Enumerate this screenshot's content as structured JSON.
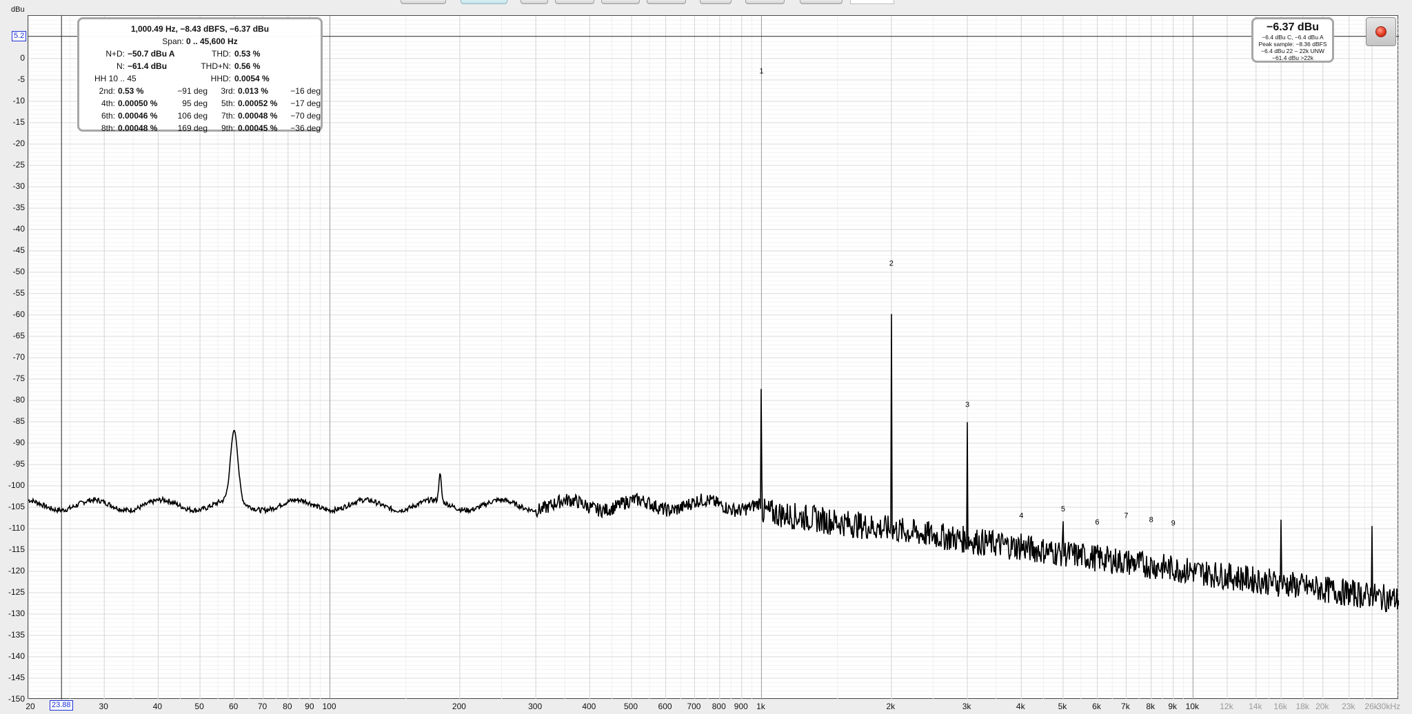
{
  "axis": {
    "unit": "dBu",
    "y_ticks": [
      "0",
      "-5",
      "-10",
      "-15",
      "-20",
      "-25",
      "-30",
      "-35",
      "-40",
      "-45",
      "-50",
      "-55",
      "-60",
      "-65",
      "-70",
      "-75",
      "-80",
      "-85",
      "-90",
      "-95",
      "-100",
      "-105",
      "-110",
      "-115",
      "-120",
      "-125",
      "-130",
      "-135",
      "-140",
      "-145",
      "-150"
    ],
    "x_ticks": [
      "20",
      "30",
      "40",
      "50",
      "60",
      "70",
      "80",
      "90",
      "100",
      "200",
      "300",
      "400",
      "500",
      "600",
      "700",
      "800",
      "900",
      "1k",
      "2k",
      "3k",
      "4k",
      "5k",
      "6k",
      "7k",
      "8k",
      "9k",
      "10k",
      "12k",
      "14k",
      "16k",
      "18k",
      "20k",
      "23k",
      "26k",
      "30kHz"
    ],
    "x_tick_values": [
      20,
      30,
      40,
      50,
      60,
      70,
      80,
      90,
      100,
      200,
      300,
      400,
      500,
      600,
      700,
      800,
      900,
      1000,
      2000,
      3000,
      4000,
      5000,
      6000,
      7000,
      8000,
      9000,
      10000,
      12000,
      14000,
      16000,
      18000,
      20000,
      23000,
      26000,
      30000
    ]
  },
  "cursor": {
    "level": "5.2",
    "freq": "23.88"
  },
  "stats": {
    "header": "1,000.49 Hz, −8.43 dBFS, −6.37 dBu",
    "span_label": "Span:",
    "span_value": "0 .. 45,600 Hz",
    "nd_label": "N+D:",
    "nd_value": "−50.7 dBu A",
    "thd_label": "THD:",
    "thd_value": "0.53 %",
    "n_label": "N:",
    "n_value": "−61.4 dBu",
    "thdn_label": "THD+N:",
    "thdn_value": "0.56 %",
    "hh_label": "HH 10 .. 45",
    "hhd_label": "HHD:",
    "hhd_value": "0.0054 %",
    "harmonics": [
      {
        "label": "2nd:",
        "value": "0.53 %",
        "phase": "−91 deg"
      },
      {
        "label": "3rd:",
        "value": "0.013 %",
        "phase": "−16 deg"
      },
      {
        "label": "4th:",
        "value": "0.00050 %",
        "phase": "95 deg"
      },
      {
        "label": "5th:",
        "value": "0.00052 %",
        "phase": "−17 deg"
      },
      {
        "label": "6th:",
        "value": "0.00046 %",
        "phase": "106 deg"
      },
      {
        "label": "7th:",
        "value": "0.00048 %",
        "phase": "−70 deg"
      },
      {
        "label": "8th:",
        "value": "0.00048 %",
        "phase": "169 deg"
      },
      {
        "label": "9th:",
        "value": "0.00045 %",
        "phase": "−36 deg"
      }
    ]
  },
  "level": {
    "big": "−6.37 dBu",
    "line1": "−6.4 dBu C, −6.4 dBu A",
    "line2": "Peak sample: −8.36 dBFS",
    "line3": "−6.4 dBu 22 – 22k UNW",
    "line4": "−61.4 dBu >22k"
  },
  "markers": [
    "1",
    "2",
    "3",
    "4",
    "5",
    "6",
    "7",
    "8",
    "9"
  ],
  "record_button": {
    "icon": "record-icon"
  },
  "colors": {
    "trace": "#000000",
    "cursor": "#1b2fd6",
    "record": "#e0331b"
  }
}
